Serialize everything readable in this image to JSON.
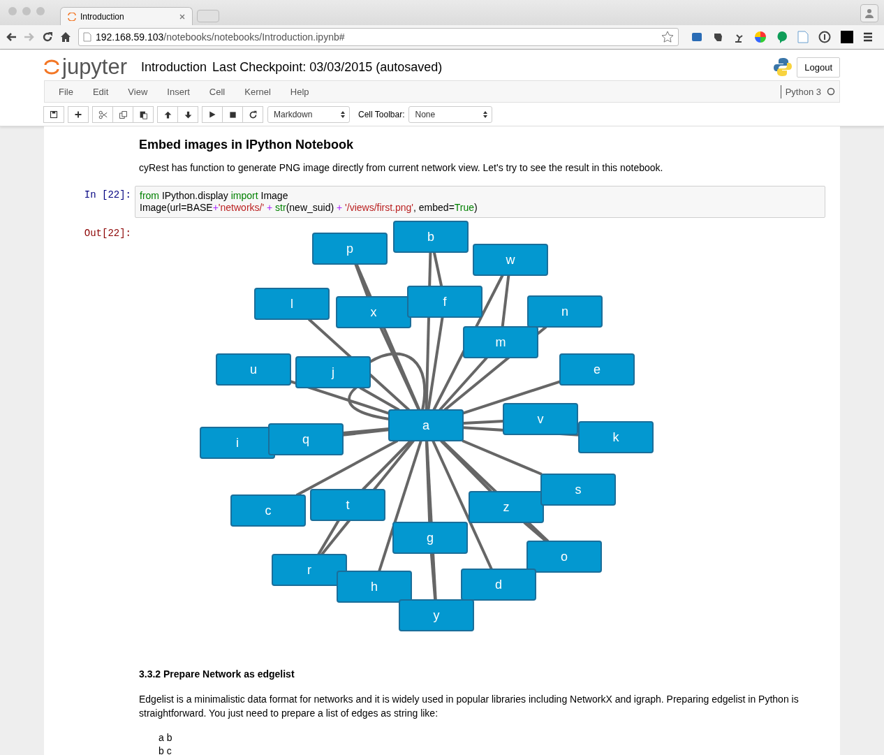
{
  "browser": {
    "tab_title": "Introduction",
    "url_host": "192.168.59.103",
    "url_path": "/notebooks/notebooks/Introduction.ipynb#"
  },
  "header": {
    "logo": "jupyter",
    "title": "Introduction",
    "checkpoint": "Last Checkpoint: 03/03/2015 (autosaved)",
    "logout": "Logout"
  },
  "menu": [
    "File",
    "Edit",
    "View",
    "Insert",
    "Cell",
    "Kernel",
    "Help"
  ],
  "kernel": "Python 3",
  "toolbar": {
    "cell_type": "Markdown",
    "cell_toolbar_label": "Cell Toolbar:",
    "cell_toolbar_value": "None"
  },
  "cells": [
    {
      "kind": "heading",
      "text": "Embed images in IPython Notebook"
    },
    {
      "kind": "paragraph",
      "text": "cyRest has function to generate PNG image directly from current network view. Let's try to see the result in this notebook."
    },
    {
      "kind": "code",
      "prompt": "In [22]:",
      "lines": [
        [
          {
            "kind": "keyword",
            "text": "from"
          },
          {
            "kind": "plain",
            "text": " IPython.display "
          },
          {
            "kind": "keyword",
            "text": "import"
          },
          {
            "kind": "plain",
            "text": " Image"
          }
        ],
        [
          {
            "kind": "plain",
            "text": "Image(url=BASE"
          },
          {
            "kind": "operator",
            "text": "+"
          },
          {
            "kind": "string",
            "text": "'networks/'"
          },
          {
            "kind": "operator",
            "text": " + "
          },
          {
            "kind": "builtin",
            "text": "str"
          },
          {
            "kind": "plain",
            "text": "(new_suid) "
          },
          {
            "kind": "operator",
            "text": "+ "
          },
          {
            "kind": "string",
            "text": "'/views/first.png'"
          },
          {
            "kind": "plain",
            "text": ", embed="
          },
          {
            "kind": "keyword",
            "text": "True"
          },
          {
            "kind": "plain",
            "text": ")"
          }
        ]
      ]
    },
    {
      "kind": "output",
      "prompt": "Out[22]:",
      "nodes": [
        "p",
        "b",
        "w",
        "l",
        "x",
        "f",
        "n",
        "m",
        "u",
        "j",
        "e",
        "a",
        "v",
        "k",
        "i",
        "q",
        "c",
        "t",
        "z",
        "s",
        "g",
        "o",
        "r",
        "h",
        "d",
        "y"
      ]
    },
    {
      "kind": "subheading",
      "text": "3.3.2 Prepare Network as edgelist"
    },
    {
      "kind": "paragraph",
      "text": "Edgelist is a minimalistic data format for networks and it is widely used in popular libraries including NetworkX and igraph. Preparing edgelist in Python is straightforward. You just need to prepare a list of edges as string like:"
    },
    {
      "kind": "preformatted",
      "lines": [
        "a b",
        "b c"
      ]
    }
  ]
}
